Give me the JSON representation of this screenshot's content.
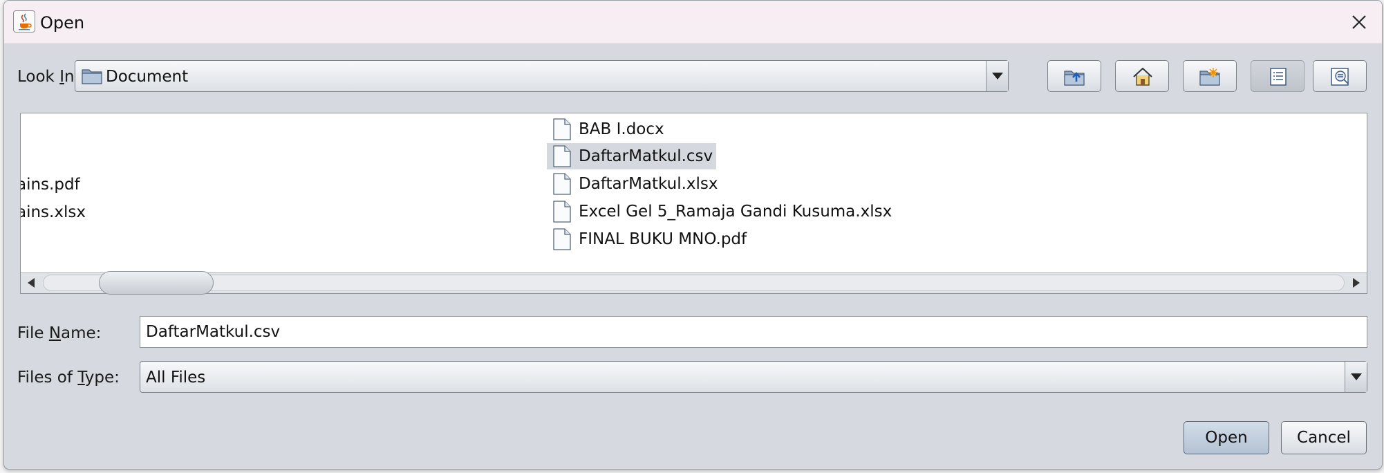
{
  "window": {
    "title": "Open",
    "icon": "java-coffee-cup-icon"
  },
  "look_in": {
    "label_pre": "Look ",
    "label_mnemonic": "I",
    "label_post": "n:",
    "selected": "Document",
    "icon": "folder-icon"
  },
  "toolbar": {
    "buttons": [
      {
        "name": "up-one-level",
        "icon": "folder-up-icon"
      },
      {
        "name": "home",
        "icon": "home-icon"
      },
      {
        "name": "create-new-folder",
        "icon": "new-folder-icon"
      },
      {
        "name": "list-view",
        "icon": "list-view-icon",
        "active": true
      },
      {
        "name": "details-view",
        "icon": "details-view-icon"
      }
    ]
  },
  "file_list": {
    "left_column_partial": [
      "ains.pdf",
      "ains.xlsx"
    ],
    "files": [
      {
        "name": "BAB I.docx",
        "selected": false,
        "icon": "file-icon"
      },
      {
        "name": "DaftarMatkul.csv",
        "selected": true,
        "icon": "file-icon"
      },
      {
        "name": "DaftarMatkul.xlsx",
        "selected": false,
        "icon": "file-icon"
      },
      {
        "name": "Excel Gel 5_Ramaja Gandi Kusuma.xlsx",
        "selected": false,
        "icon": "file-icon"
      },
      {
        "name": "FINAL BUKU MNO.pdf",
        "selected": false,
        "icon": "file-icon"
      }
    ]
  },
  "file_name": {
    "label_pre": "File ",
    "label_mnemonic": "N",
    "label_post": "ame:",
    "value": "DaftarMatkul.csv"
  },
  "files_of_type": {
    "label_pre": "Files of ",
    "label_mnemonic": "T",
    "label_post": "ype:",
    "selected": "All Files"
  },
  "buttons": {
    "open": "Open",
    "cancel": "Cancel"
  },
  "colors": {
    "dialog_bg": "#d6d9df",
    "selection_bg": "#d5d9df",
    "default_button": "#c2cede"
  }
}
